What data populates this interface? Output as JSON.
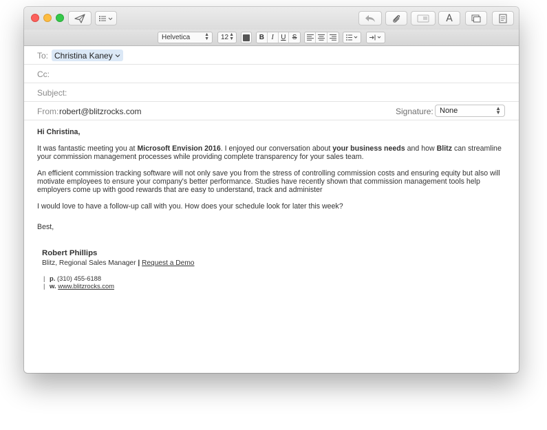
{
  "toolbar": {
    "format_font": "Helvetica",
    "format_size": "12",
    "color_swatch": "#555555"
  },
  "header": {
    "to_label": "To:",
    "to_recipient": "Christina Kaney",
    "cc_label": "Cc:",
    "subject_label": "Subject:",
    "from_label": "From:",
    "from_value": "robert@blitzrocks.com",
    "signature_label": "Signature:",
    "signature_value": "None"
  },
  "message": {
    "greeting": "Hi Christina,",
    "p1": {
      "a": "It was fantastic meeting you at ",
      "b": "Microsoft Envision 2016",
      "c": ". I enjoyed our conversation about ",
      "d": "your business needs",
      "e": " and how ",
      "f": "Blitz",
      "g": " can streamline your commission management processes while providing complete transparency for your sales team."
    },
    "p2": "An efficient commission tracking software will not only save you from the stress of controlling commission costs and ensuring equity but also will motivate employees to ensure your company's better performance. Studies have recently shown that commission management tools help employers come up with good rewards that are easy to understand, track and administer",
    "p3": "I would love to have a follow-up call with you. How does your schedule look for later this week?",
    "closing": "Best,"
  },
  "signature": {
    "name": "Robert Phillips",
    "title": "Blitz, Regional Sales Manager",
    "separator": "|",
    "demo_link": "Request a Demo",
    "phone_prefix": "p.",
    "phone": "(310) 455-6188",
    "web_prefix": "w.",
    "web": "www.blitzrocks.com",
    "bar": "|"
  }
}
